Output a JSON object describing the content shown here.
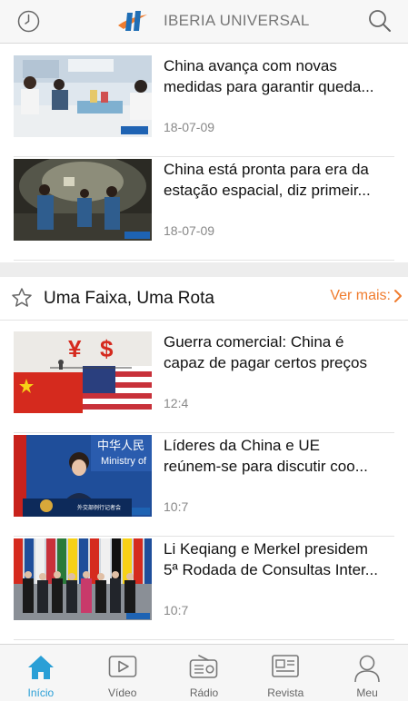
{
  "header": {
    "title": "IBERIA UNIVERSAL",
    "left_icon": "clock-icon",
    "right_icon": "search-icon"
  },
  "top_articles": [
    {
      "line1": "China avança com novas",
      "line2": "medidas para garantir queda...",
      "date": "18-07-09"
    },
    {
      "line1": "China está pronta para era da",
      "line2": "estação espacial, diz primeir...",
      "date": "18-07-09"
    }
  ],
  "section": {
    "title": "Uma Faixa, Uma Rota",
    "more_label": "Ver  mais:",
    "accent": "#f07c2e"
  },
  "section_articles": [
    {
      "line1": "Guerra comercial: China é",
      "line2": "capaz de pagar certos preços",
      "date": "12:4"
    },
    {
      "line1": "Líderes da China e UE",
      "line2": "reúnem-se para discutir coo...",
      "date": "10:7"
    },
    {
      "line1": "Li Keqiang e Merkel presidem",
      "line2": "5ª Rodada de Consultas Inter...",
      "date": "10:7"
    }
  ],
  "tabbar": {
    "tabs": [
      {
        "label": "Início",
        "icon": "home-icon",
        "active": true
      },
      {
        "label": "Vídeo",
        "icon": "video-play-icon",
        "active": false
      },
      {
        "label": "Rádio",
        "icon": "radio-icon",
        "active": false
      },
      {
        "label": "Revista",
        "icon": "magazine-icon",
        "active": false
      },
      {
        "label": "Meu",
        "icon": "user-icon",
        "active": false
      }
    ],
    "active_color": "#2a9fd6"
  }
}
